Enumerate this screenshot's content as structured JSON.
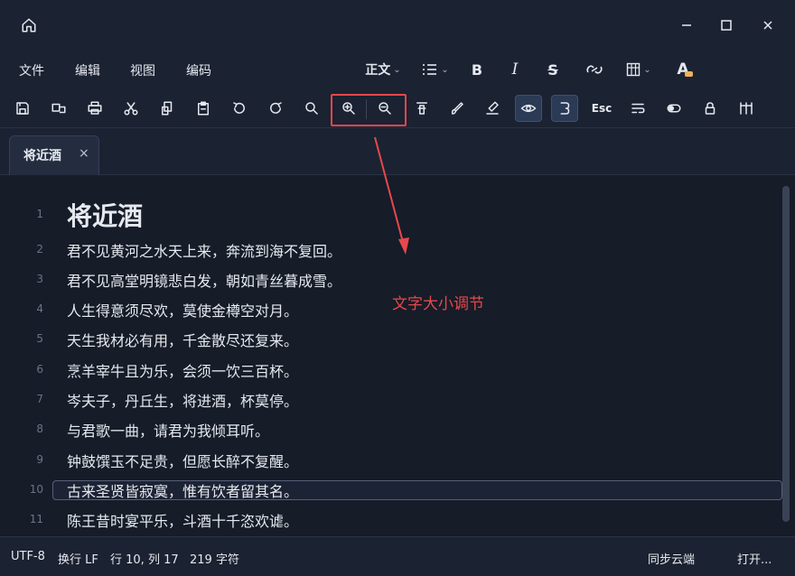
{
  "menu": {
    "file": "文件",
    "edit": "编辑",
    "view": "视图",
    "encoding": "编码"
  },
  "format": {
    "paragraph_style": "正文",
    "bold": "B",
    "italic": "I",
    "strike": "S",
    "font_color": "A"
  },
  "toolbar": {
    "esc": "Esc"
  },
  "tab": {
    "title": "将近酒",
    "close": "×"
  },
  "editor": {
    "lines": [
      {
        "no": "1",
        "text": "将近酒"
      },
      {
        "no": "2",
        "text": "君不见黄河之水天上来，奔流到海不复回。"
      },
      {
        "no": "3",
        "text": "君不见高堂明镜悲白发，朝如青丝暮成雪。"
      },
      {
        "no": "4",
        "text": "人生得意须尽欢，莫使金樽空对月。"
      },
      {
        "no": "5",
        "text": "天生我材必有用，千金散尽还复来。"
      },
      {
        "no": "6",
        "text": "烹羊宰牛且为乐，会须一饮三百杯。"
      },
      {
        "no": "7",
        "text": "岑夫子，丹丘生，将进酒，杯莫停。"
      },
      {
        "no": "8",
        "text": "与君歌一曲，请君为我倾耳听。"
      },
      {
        "no": "9",
        "text": "钟鼓馔玉不足贵，但愿长醉不复醒。"
      },
      {
        "no": "10",
        "text": "古来圣贤皆寂寞，惟有饮者留其名。"
      },
      {
        "no": "11",
        "text": "陈王昔时宴平乐，斗酒十千恣欢谑。"
      }
    ]
  },
  "annotation": {
    "text": "文字大小调节",
    "color": "#e5484d"
  },
  "status": {
    "encoding": "UTF-8",
    "line_ending": "换行 LF",
    "cursor": "行 10, 列 17",
    "char_count": "219 字符",
    "sync": "同步云端",
    "open": "打开..."
  },
  "colors": {
    "background": "#1b2232",
    "editor_bg": "#161c28",
    "accent_red": "#e5484d",
    "active_btn": "#2b3a55"
  }
}
